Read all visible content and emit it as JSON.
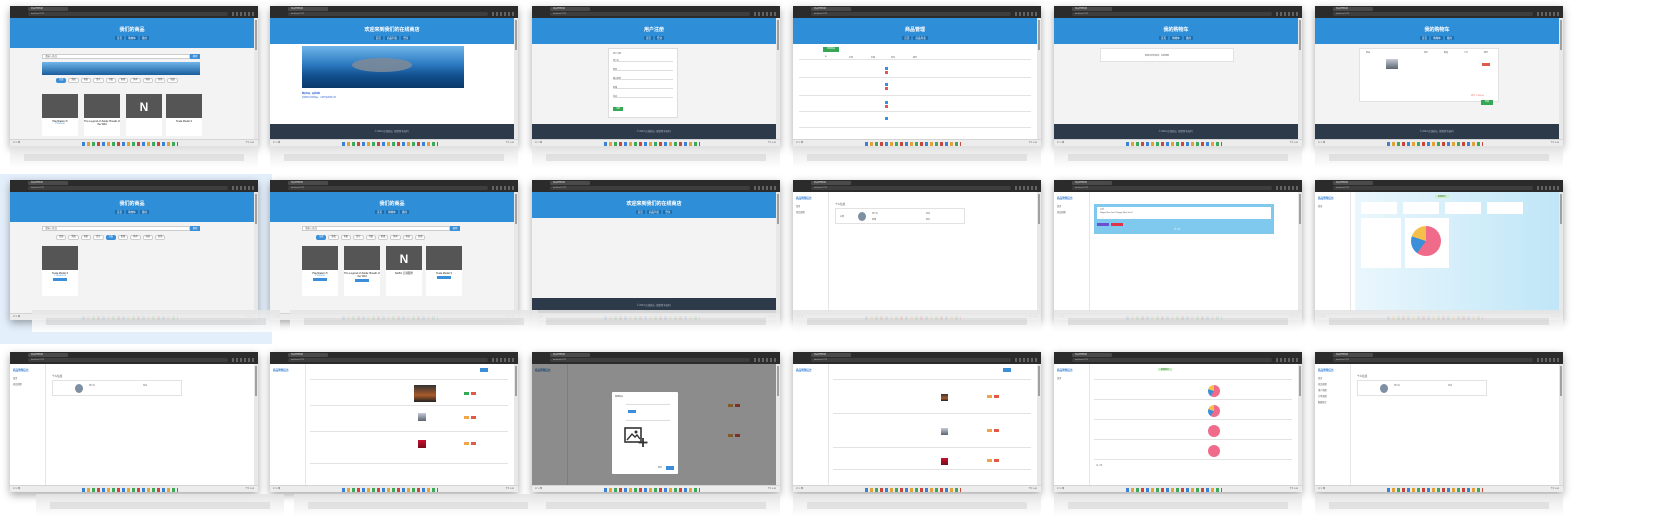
{
  "browser": {
    "tab_title": "商品管理系统",
    "url": "localhost:5173",
    "weather": "27°C 晴",
    "clock": "下午 3:42"
  },
  "shop": {
    "title": "我们的商品",
    "nav": [
      "首页",
      "购物车",
      "我的"
    ],
    "search_placeholder": "请输入商品",
    "search_button": "搜索",
    "categories": [
      "全部",
      "游戏",
      "电影",
      "音乐",
      "书籍",
      "影视",
      "体育",
      "科技",
      "其他",
      "动漫"
    ],
    "products": [
      {
        "name": "PlayStation 5",
        "price": "¥ 3999.00"
      },
      {
        "name": "The Legend of Zelda: Breath of the Wild",
        "price": "¥ 459.00"
      },
      {
        "name": "Netflix 订阅服务",
        "price": "¥ 39.00"
      },
      {
        "name": "Tesla Model 3",
        "price": "¥ 265900.00"
      }
    ],
    "filtered_product": {
      "name": "Tesla Model 3",
      "price": "¥ 265900.00"
    }
  },
  "welcome": {
    "title": "欢迎来到我们的在线商店",
    "nav": [
      "首页",
      "商品列表",
      "登录"
    ],
    "links_title": "精选商品，品质保障",
    "links_text": "发现更多优质商品，立即开始购物之旅",
    "footer": "© 2024 在线商店. 保留所有权利."
  },
  "register": {
    "title": "用户注册",
    "form_title": "用户注册",
    "fields": [
      "用户名",
      "密码",
      "确认密码",
      "邮箱",
      "电话"
    ],
    "submit": "注册"
  },
  "manage": {
    "title": "商品管理",
    "add_button": "添加商品",
    "columns": [
      "ID",
      "名称",
      "价格",
      "库存",
      "操作"
    ]
  },
  "cart": {
    "title": "我的购物车",
    "empty_text": "购物车空空如也，去购物吧",
    "columns": [
      "商品",
      "单价",
      "数量",
      "小计",
      "操作"
    ],
    "total": "总计: ¥ 459.00",
    "checkout": "结算"
  },
  "admin": {
    "brand": "商品管理后台",
    "menu": [
      "首页",
      "商品管理",
      "用户管理",
      "订单管理",
      "数据统计"
    ],
    "profile_title": "个人信息",
    "profile_fields": [
      "用户名",
      "邮箱",
      "电话",
      "地址"
    ],
    "notice_title": "公告",
    "notice_text": "Happy New Year!! Happy New Year!!!",
    "edit": "编辑",
    "delete": "删除",
    "stats_badge": "数据统计",
    "upload_title": "编辑商品",
    "cancel": "取消",
    "confirm": "确定",
    "pager": "共 4 条"
  },
  "colors": {
    "accent": "#2e8ed8",
    "footer": "#2d3a4a",
    "success": "#34a853",
    "danger": "#e05a4c",
    "warning": "#f3a34a",
    "pie_pink": "#f06a8a"
  }
}
